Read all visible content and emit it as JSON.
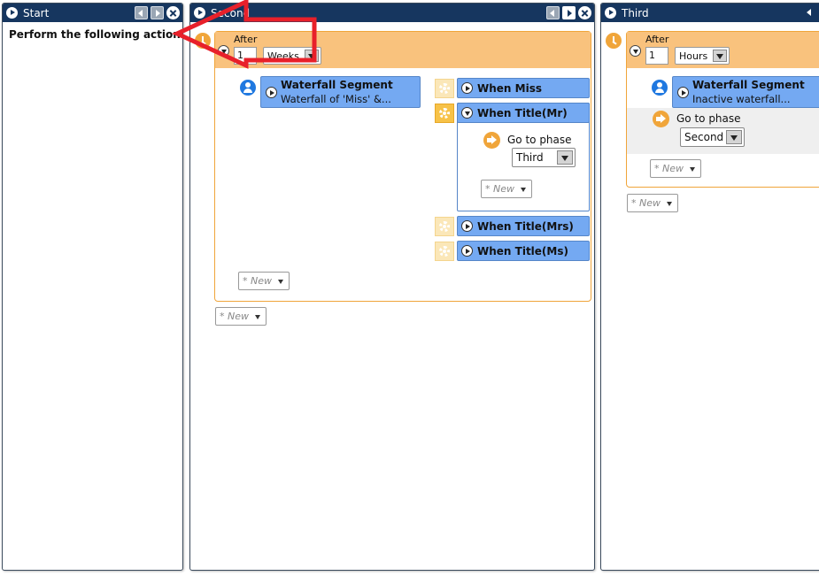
{
  "panels": {
    "start": {
      "title": "Start",
      "body_text": "Perform the following actions"
    },
    "second": {
      "title": "Second",
      "trigger": {
        "label": "After",
        "amount": "1",
        "unit": "Weeks"
      },
      "segment": {
        "title": "Waterfall Segment",
        "subtitle": "Waterfall of 'Miss' &..."
      },
      "branches": [
        {
          "label": "When Miss"
        },
        {
          "label": "When Title(Mr)",
          "action_label": "Go to phase",
          "phase": "Third",
          "new_label": "* New"
        },
        {
          "label": "When Title(Mrs)"
        },
        {
          "label": "When Title(Ms)"
        }
      ],
      "inner_new_label": "* New",
      "outer_new_label": "* New"
    },
    "third": {
      "title": "Third",
      "trigger": {
        "label": "After",
        "amount": "1",
        "unit": "Hours"
      },
      "segment": {
        "title": "Waterfall Segment",
        "subtitle": "Inactive waterfall..."
      },
      "action_label": "Go to phase",
      "phase": "Second",
      "inner_new_label": "* New",
      "outer_new_label": "* New"
    }
  },
  "colors": {
    "header": "#16365f",
    "trigger_orange": "#f0a53a",
    "card_blue": "#74a9f2",
    "annotation_red": "#e8202a"
  }
}
